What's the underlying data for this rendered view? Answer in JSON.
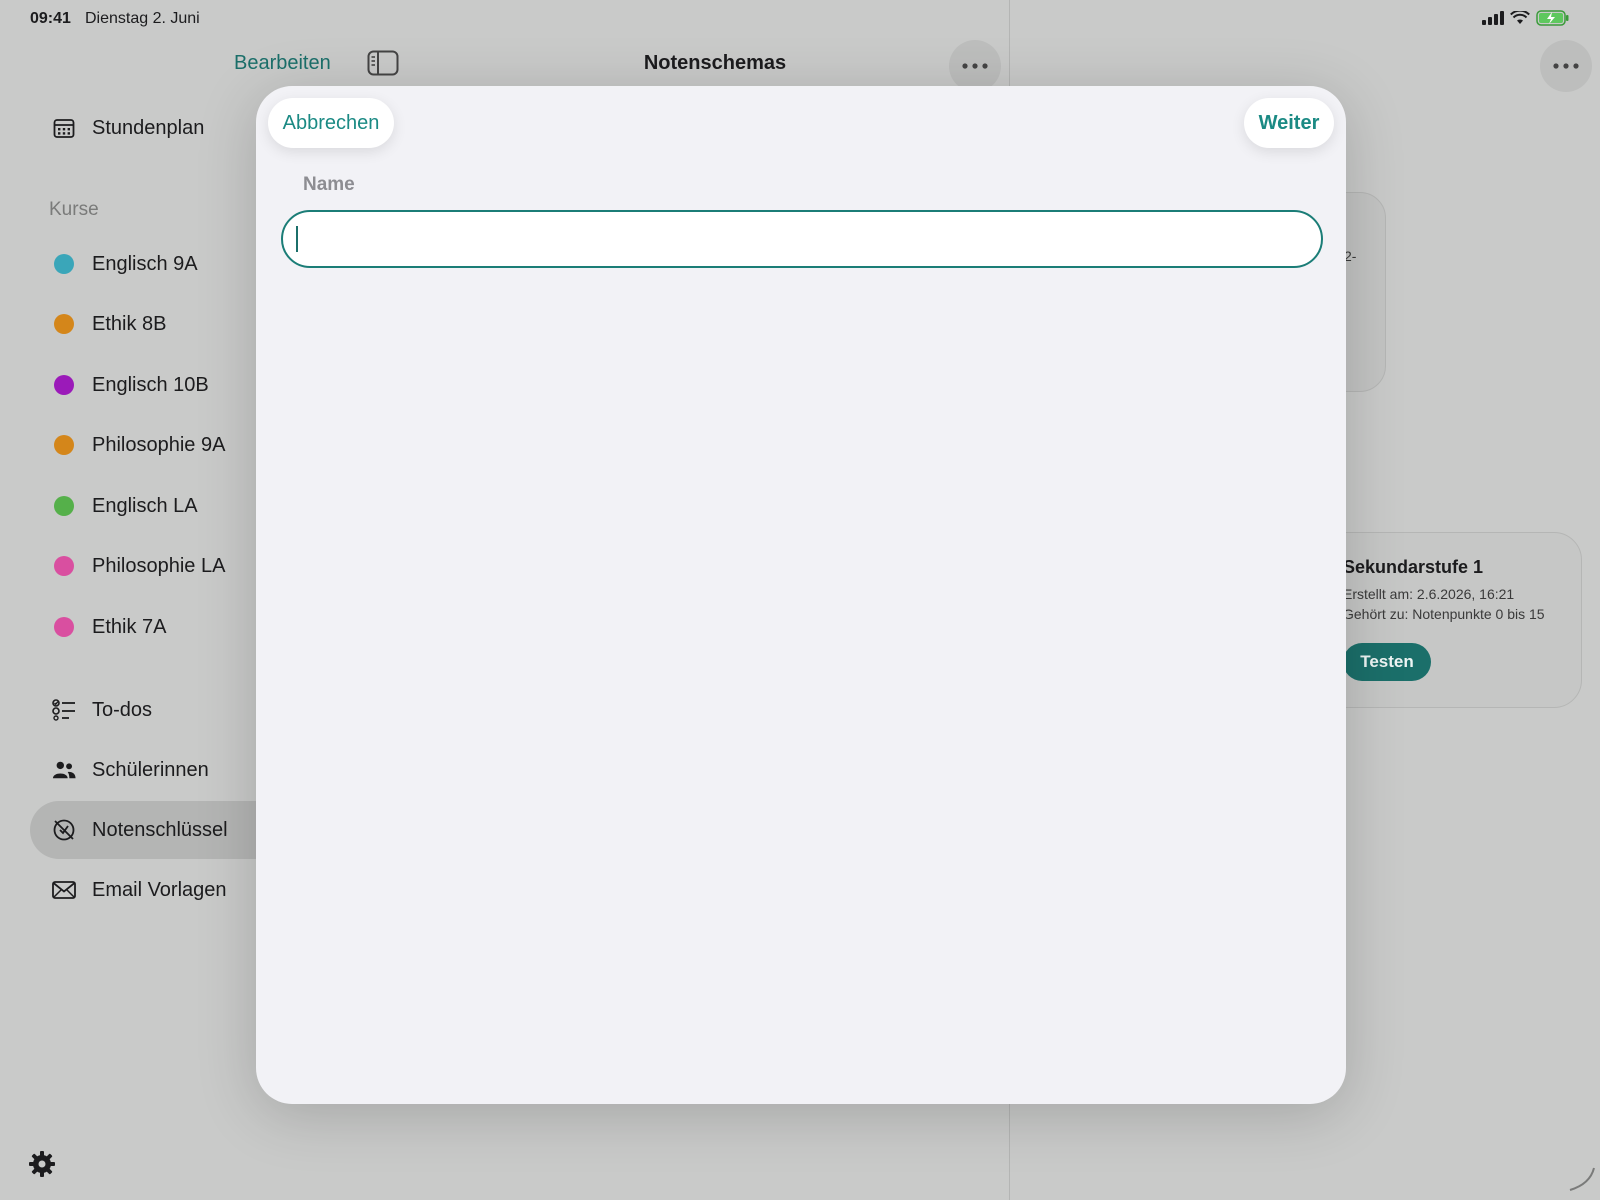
{
  "status_bar": {
    "time": "09:41",
    "date": "Dienstag 2. Juni"
  },
  "toolbar": {
    "edit_label": "Bearbeiten",
    "title": "Notenschemas"
  },
  "sidebar": {
    "top_items": [
      {
        "label": "Stundenplan",
        "icon": "calendar-icon"
      }
    ],
    "courses_label": "Kurse",
    "courses": [
      {
        "label": "Englisch 9A",
        "color": "#3aa6b9"
      },
      {
        "label": "Ethik 8B",
        "color": "#d4861a"
      },
      {
        "label": "Englisch 10B",
        "color": "#9b1ab9"
      },
      {
        "label": "Philosophie 9A",
        "color": "#d4861a"
      },
      {
        "label": "Englisch LA",
        "color": "#55b04a"
      },
      {
        "label": "Philosophie LA",
        "color": "#d94fa0"
      },
      {
        "label": "Ethik 7A",
        "color": "#d94fa0"
      }
    ],
    "bottom_items": [
      {
        "label": "To-dos",
        "icon": "checklist-icon"
      },
      {
        "label": "Schülerinnen",
        "icon": "people-icon"
      },
      {
        "label": "Notenschlüssel",
        "icon": "grade-key-icon",
        "active": true
      },
      {
        "label": "Email Vorlagen",
        "icon": "envelope-icon"
      }
    ]
  },
  "background_cards": {
    "top_card_fragment": "2-",
    "card": {
      "title": "Sekundarstufe 1",
      "created": "Erstellt am: 2.6.2026, 16:21",
      "belongs": "Gehört zu: Notenpunkte 0 bis 15",
      "button": "Testen"
    }
  },
  "modal": {
    "cancel_label": "Abbrechen",
    "next_label": "Weiter",
    "field_label": "Name",
    "name_value": "",
    "name_placeholder": ""
  },
  "colors": {
    "accent": "#1b8a84",
    "accent_dark": "#1b6f6a"
  }
}
